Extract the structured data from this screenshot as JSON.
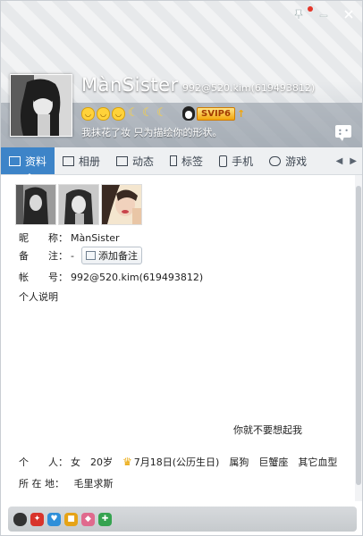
{
  "header": {
    "name": "MànSister",
    "account": "992@520.kim(619493812)",
    "signature": "我抹花了妆 只为描绘你的形状。",
    "vip_label": "SVIP6",
    "vip_up": "↑",
    "badges": [
      "face",
      "face",
      "face",
      "moon",
      "moon",
      "moon"
    ]
  },
  "window_controls": [
    "pin-icon",
    "minimize-icon",
    "close-icon"
  ],
  "tabs": [
    {
      "label": "资料",
      "icon": "profile-card-icon",
      "active": true
    },
    {
      "label": "相册",
      "icon": "photo-album-icon",
      "active": false
    },
    {
      "label": "动态",
      "icon": "feed-list-icon",
      "active": false
    },
    {
      "label": "标签",
      "icon": "bookmark-icon",
      "active": false
    },
    {
      "label": "手机",
      "icon": "phone-icon",
      "active": false
    },
    {
      "label": "游戏",
      "icon": "game-icon",
      "active": false
    }
  ],
  "tab_nav": {
    "prev": "◀",
    "next": "▶"
  },
  "profile": {
    "nickname_label": "昵　　称：",
    "nickname": "MànSister",
    "remark_label": "备　　注：",
    "remark_value": "-",
    "remark_button": "添加备注",
    "account_label": "帐　　号：",
    "account": "992@520.kim(619493812)",
    "intro_label": "个人说明",
    "intro_text": "你就不要想起我",
    "personal_label": "个　　人：",
    "gender": "女",
    "age": "20岁",
    "birthday": "7月18日(公历生日)",
    "zodiac": "属狗",
    "constellation": "巨蟹座",
    "blood": "其它血型",
    "location_label": "所 在 地：",
    "location": "毛里求斯"
  },
  "colors": {
    "tab_active": "#3d84c8",
    "vip_gold": "#f2a60c"
  },
  "footer_icons": [
    "qq-penguin-icon",
    "red-badge-icon",
    "blue-heart-icon",
    "yellow-gift-icon",
    "pink-diamond-icon",
    "green-badge-icon"
  ]
}
